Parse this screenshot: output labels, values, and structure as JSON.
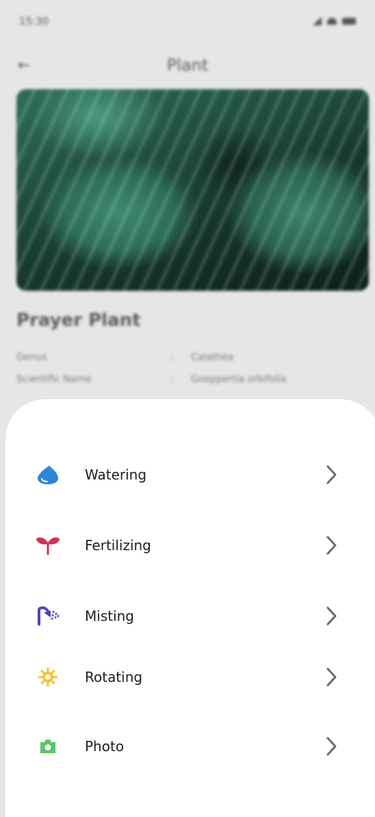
{
  "status_bar": {
    "time": "15:30"
  },
  "header": {
    "title": "Plant",
    "back_icon": "back-arrow-icon"
  },
  "plant": {
    "name": "Prayer Plant",
    "details": [
      {
        "key": "Genus",
        "value": "Calathea"
      },
      {
        "key": "Scientific Name",
        "value": "Goeppertia orbifolia"
      }
    ]
  },
  "menu": {
    "items": [
      {
        "label": "Watering",
        "icon": "water-drop-icon",
        "color": "#2e86d6"
      },
      {
        "label": "Fertilizing",
        "icon": "sprout-icon",
        "color": "#d0324f"
      },
      {
        "label": "Misting",
        "icon": "shower-icon",
        "color": "#5a3fb0"
      },
      {
        "label": "Rotating",
        "icon": "sun-rotate-icon",
        "color": "#f2c230"
      },
      {
        "label": "Photo",
        "icon": "camera-icon",
        "color": "#5cc66d"
      }
    ]
  }
}
